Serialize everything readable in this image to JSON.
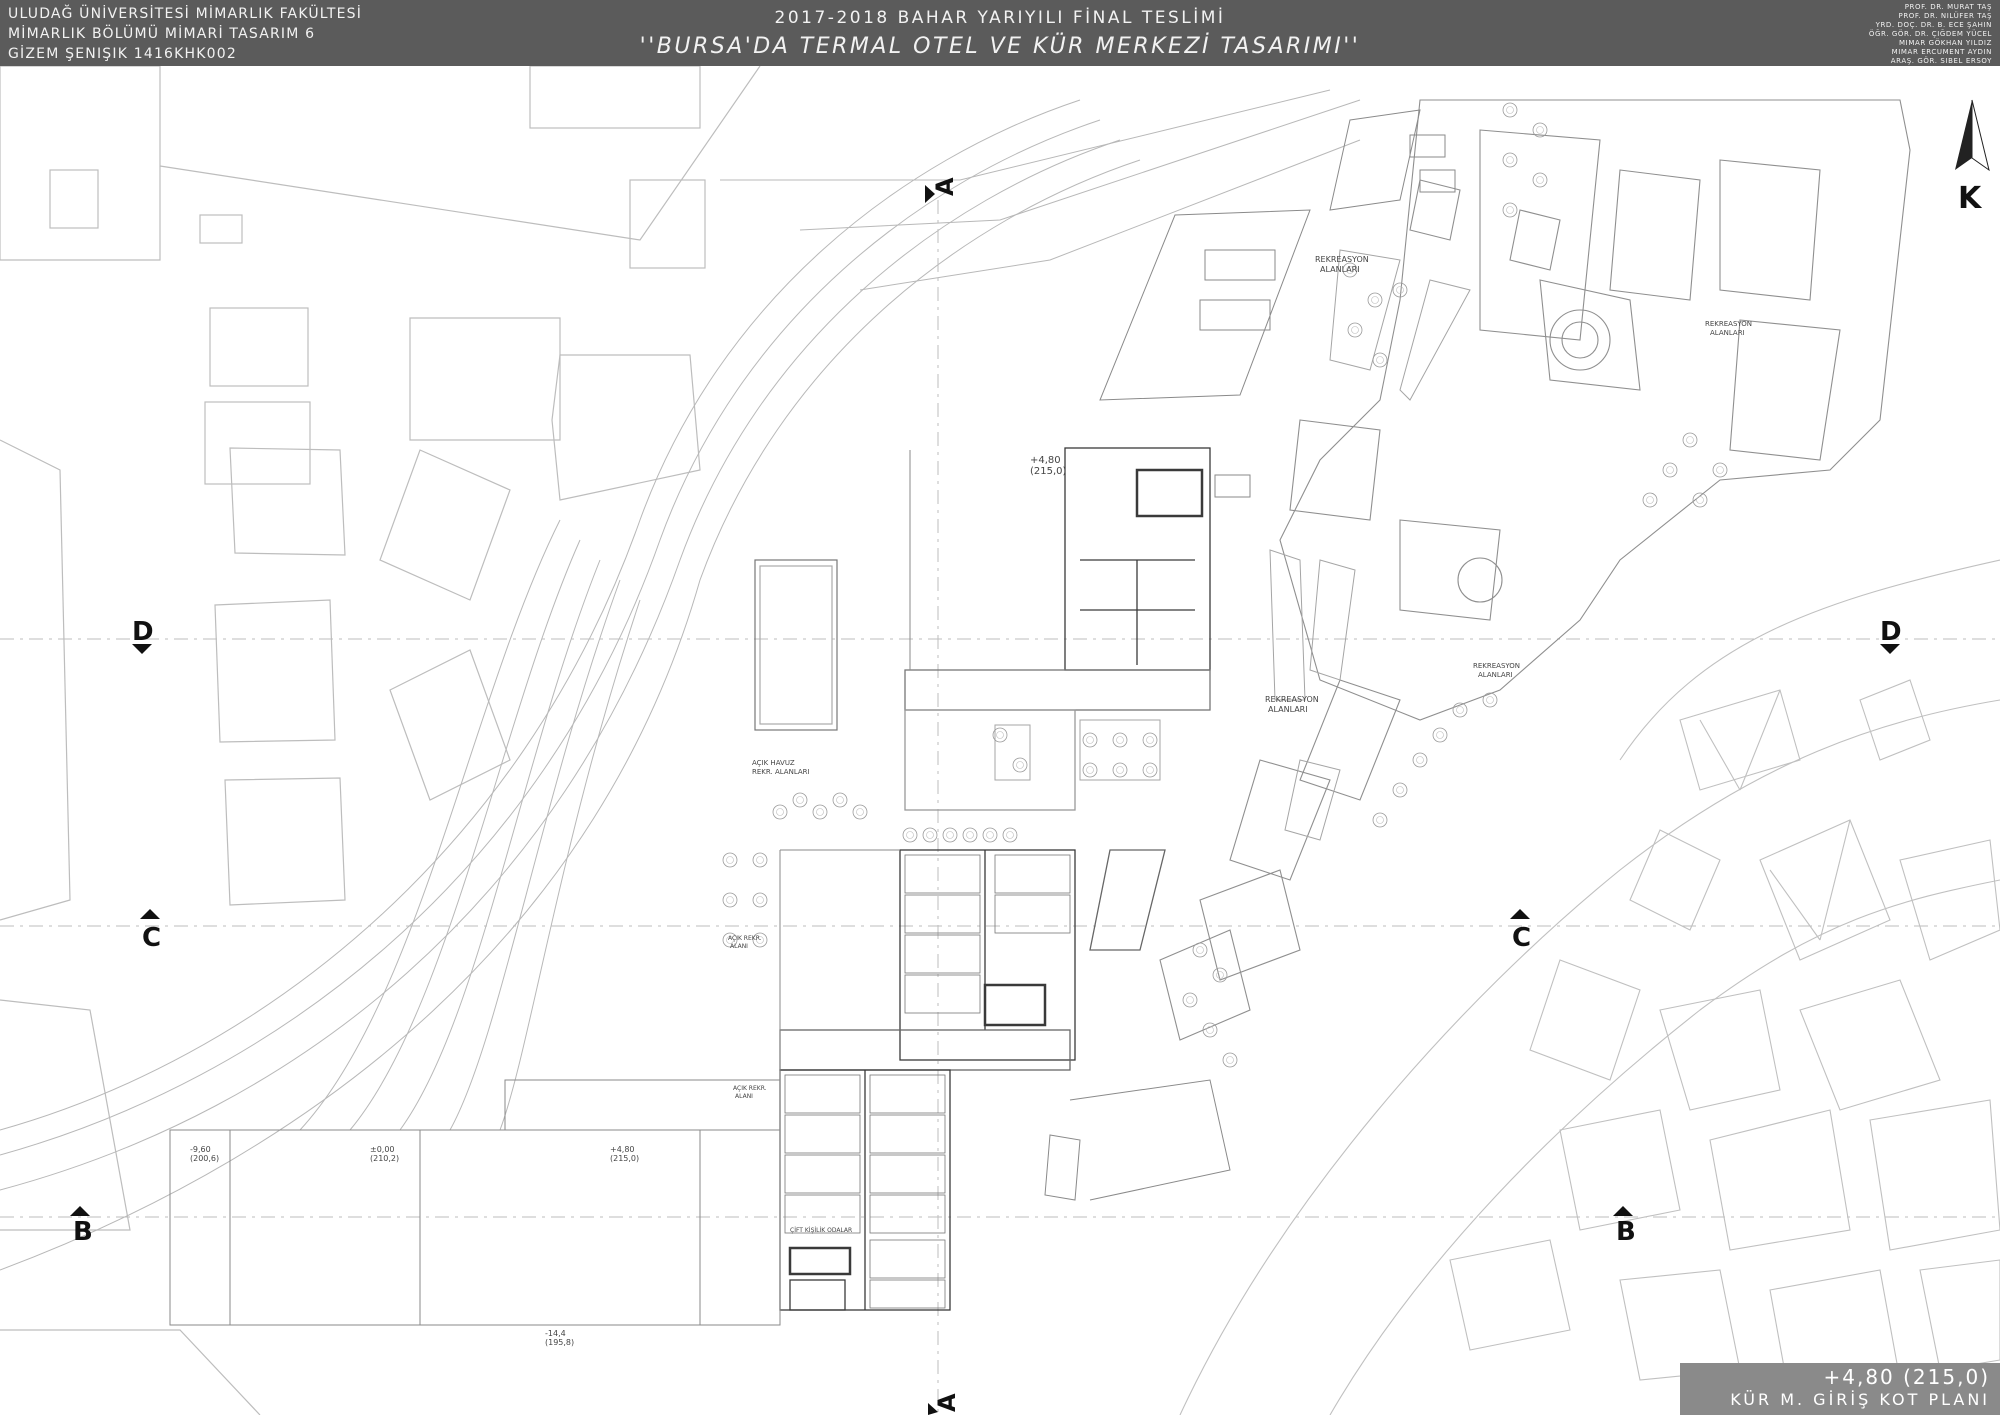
{
  "header": {
    "faculty": "ULUDAĞ ÜNİVERSİTESİ MİMARLIK FAKÜLTESİ",
    "course": "MİMARLIK BÖLÜMÜ MİMARİ TASARIM 6",
    "student": "GİZEM ŞENIŞIK 1416KHK002",
    "term": "2017-2018 BAHAR YARIYILI FİNAL TESLİMİ",
    "project": "''BURSA'DA TERMAL OTEL VE  KÜR MERKEZİ TASARIMI''",
    "instructors": [
      "Prof. Dr. Murat Taş",
      "Prof. Dr. Nilüfer Taş",
      "Yrd. Doç. Dr. B. Ece Şahin",
      "Öğr. Gör. Dr. Çiğdem Yücel",
      "Mimar Gökhan Yıldız",
      "Mimar Ercument Aydın",
      "Araş. Gör. Sibel Ersoy"
    ]
  },
  "north_arrow": {
    "label": "K"
  },
  "section_markers": {
    "a_top": "A",
    "a_bottom": "A",
    "b_left": "B",
    "b_right": "B",
    "c_left": "C",
    "c_right": "C",
    "d_left": "D",
    "d_right": "D"
  },
  "area_labels": {
    "recreation_1": "REKREASYON",
    "recreation_1b": "ALANLARI",
    "recreation_2": "REKREASYON",
    "recreation_2b": "ALANLARI",
    "recreation_3": "REKREASYON",
    "recreation_3b": "ALANLARI",
    "recreation_4": "REKREASYON",
    "recreation_4b": "ALANLARI",
    "open_pool": "AÇIK HAVUZ",
    "open_pool_b": "REKR. ALANLARI",
    "open_recreation": "AÇIK REKR.",
    "open_recreation_b": "ALANI",
    "open_recreation_2": "AÇIK REKR.",
    "open_recreation_2b": "ALANI",
    "double_rooms": "ÇİFT KİŞİLİK ODALAR"
  },
  "levels": {
    "main_entry": "+4,80",
    "main_entry_abs": "(215,0)",
    "l_minus960": "-9,60",
    "l_minus960_abs": "(200,6)",
    "l_000": "±0,00",
    "l_000_abs": "(210,2)",
    "l_480_south": "+4,80",
    "l_480_south_abs": "(215,0)",
    "l_minus144": "-14,4",
    "l_minus144_abs": "(195,8)"
  },
  "stamp": {
    "level": "+4,80 (215,0)",
    "title": "KÜR M. GİRİŞ KOT PLANI"
  }
}
